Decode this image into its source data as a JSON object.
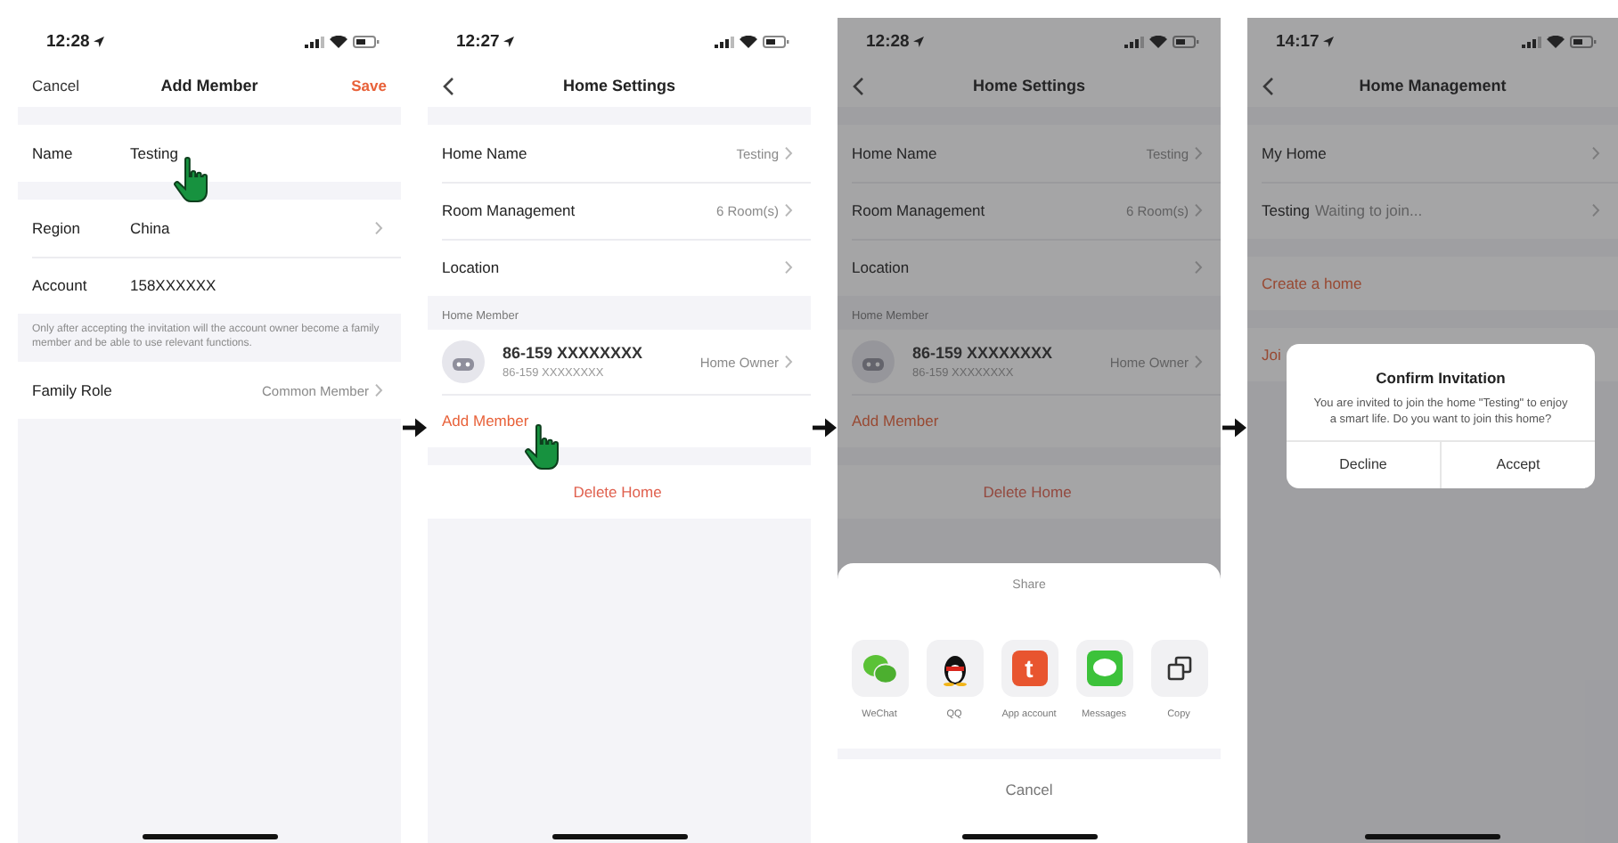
{
  "screens": [
    {
      "time": "12:28",
      "nav": {
        "left_text": "Cancel",
        "title": "Add Member",
        "right_text": "Save"
      },
      "dimmed": false,
      "sections": [
        {
          "kind": "group",
          "items": [
            {
              "kind": "field",
              "label": "Name",
              "value": "Testing",
              "chevron": false,
              "touch_hint": true
            }
          ]
        },
        {
          "kind": "group",
          "items": [
            {
              "kind": "field",
              "label": "Region",
              "value": "China",
              "chevron": true,
              "touch_hint": false
            },
            {
              "kind": "field",
              "label": "Account",
              "value": "158XXXXXX",
              "chevron": false,
              "touch_hint": false
            }
          ]
        },
        {
          "kind": "note",
          "text": "Only after accepting the invitation will the account owner become a family member and be able to use relevant functions."
        },
        {
          "kind": "group",
          "items": [
            {
              "kind": "setting",
              "label": "Family Role",
              "value": "Common Member",
              "chevron": true
            }
          ]
        }
      ]
    },
    {
      "time": "12:27",
      "nav": {
        "title": "Home Settings"
      },
      "dimmed": false,
      "sections": [
        {
          "kind": "group",
          "items": [
            {
              "kind": "setting",
              "label": "Home Name",
              "value": "Testing",
              "chevron": true
            },
            {
              "kind": "setting",
              "label": "Room Management",
              "value": "6 Room(s)",
              "chevron": true
            },
            {
              "kind": "setting",
              "label": "Location",
              "chevron": true
            }
          ]
        },
        {
          "kind": "header",
          "text": "Home Member"
        },
        {
          "kind": "group",
          "items": [
            {
              "kind": "member",
              "name": "86-159 XXXXXXXX",
              "sub": "86-159 XXXXXXXX",
              "role": "Home Owner",
              "chevron": true
            },
            {
              "kind": "link",
              "text": "Add Member",
              "touch_hint": true
            }
          ]
        },
        {
          "kind": "group",
          "items": [
            {
              "kind": "button",
              "text": "Delete Home"
            }
          ]
        }
      ]
    },
    {
      "time": "12:28",
      "nav": {
        "title": "Home Settings"
      },
      "dimmed": true,
      "sections": [
        {
          "kind": "group",
          "items": [
            {
              "kind": "setting",
              "label": "Home Name",
              "value": "Testing",
              "chevron": true
            },
            {
              "kind": "setting",
              "label": "Room Management",
              "value": "6 Room(s)",
              "chevron": true
            },
            {
              "kind": "setting",
              "label": "Location",
              "chevron": true
            }
          ]
        },
        {
          "kind": "header",
          "text": "Home Member"
        },
        {
          "kind": "group",
          "items": [
            {
              "kind": "member",
              "name": "86-159 XXXXXXXX",
              "sub": "86-159 XXXXXXXX",
              "role": "Home Owner",
              "chevron": true
            },
            {
              "kind": "link",
              "text": "Add Member",
              "touch_hint": false
            }
          ]
        },
        {
          "kind": "group",
          "items": [
            {
              "kind": "button",
              "text": "Delete Home"
            }
          ]
        }
      ],
      "share_sheet": {
        "title": "Share",
        "apps": [
          {
            "kind": "wechat",
            "label": "WeChat"
          },
          {
            "kind": "qq",
            "label": "QQ"
          },
          {
            "kind": "app",
            "label": "App account",
            "glyph": "t"
          },
          {
            "kind": "messages",
            "label": "Messages"
          },
          {
            "kind": "copy",
            "label": "Copy"
          }
        ],
        "cancel": "Cancel"
      }
    },
    {
      "time": "14:17",
      "nav": {
        "title": "Home Management"
      },
      "dimmed": true,
      "sections": [
        {
          "kind": "group",
          "items": [
            {
              "kind": "setting",
              "label": "My Home",
              "chevron": true
            },
            {
              "kind": "status",
              "label": "Testing",
              "value": "Waiting to join...",
              "chevron": true
            }
          ]
        },
        {
          "kind": "group",
          "items": [
            {
              "kind": "link",
              "text": "Create a home",
              "touch_hint": false
            }
          ]
        },
        {
          "kind": "group",
          "items": [
            {
              "kind": "link",
              "text": "Joi",
              "touch_hint": false
            }
          ]
        }
      ],
      "dialog": {
        "title": "Confirm Invitation",
        "message": "You are invited to join the home \"Testing\" to enjoy a smart life. Do you want to join this home?",
        "buttons": [
          "Decline",
          "Accept"
        ]
      }
    }
  ]
}
